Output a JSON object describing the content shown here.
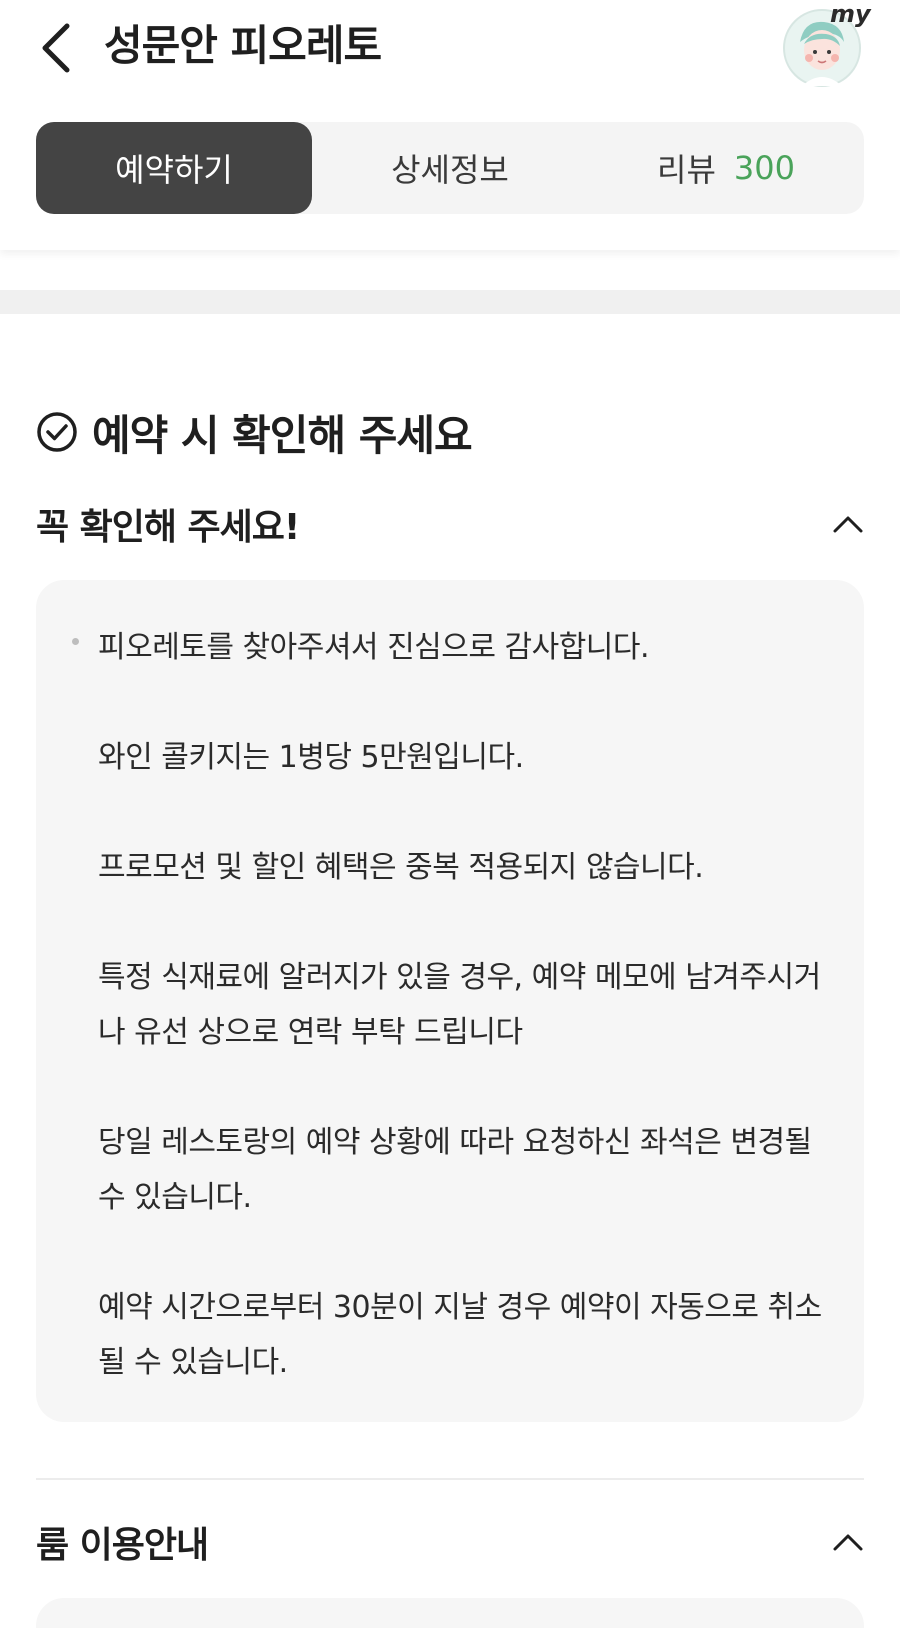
{
  "header": {
    "title": "성문안 피오레토",
    "avatar_badge": "my",
    "back_icon": "chevron-left-icon"
  },
  "tabs": [
    {
      "label": "예약하기",
      "active": true
    },
    {
      "label": "상세정보",
      "active": false
    },
    {
      "label": "리뷰",
      "count": "300",
      "active": false
    }
  ],
  "colors": {
    "active_tab_bg": "#444444",
    "review_count": "#4aa35a",
    "notice_bg": "#f6f6f6"
  },
  "section": {
    "title": "예약 시 확인해 주세요",
    "icon": "check-circle-icon"
  },
  "must_check": {
    "title": "꼭 확인해 주세요!",
    "expanded": true,
    "paragraphs": [
      "피오레토를 찾아주셔서 진심으로 감사합니다.",
      "와인 콜키지는 1병당 5만원입니다.",
      "프로모션 및 할인 혜택은 중복 적용되지 않습니다.",
      "특정 식재료에 알러지가 있을 경우, 예약 메모에 남겨주시거나 유선 상으로 연락 부탁 드립니다",
      "당일 레스토랑의 예약 상황에 따라 요청하신 좌석은 변경될 수 있습니다.",
      "예약 시간으로부터 30분이 지날 경우 예약이 자동으로 취소 될 수 있습니다."
    ]
  },
  "room_info": {
    "title": "룸 이용안내",
    "expanded": true
  }
}
